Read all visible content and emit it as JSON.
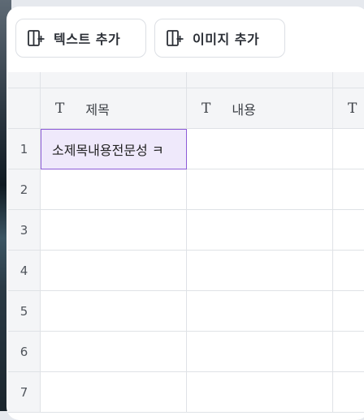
{
  "toolbar": {
    "add_text_label": "텍스트 추가",
    "add_image_label": "이미지 추가"
  },
  "table": {
    "columns": [
      {
        "type_icon": "T",
        "name": "제목"
      },
      {
        "type_icon": "T",
        "name": "내용"
      },
      {
        "type_icon": "T",
        "name": ""
      }
    ],
    "rows": [
      {
        "num": "1",
        "cells": [
          "소제목내용전문성 ㅋ",
          "",
          ""
        ]
      },
      {
        "num": "2",
        "cells": [
          "",
          "",
          ""
        ]
      },
      {
        "num": "3",
        "cells": [
          "",
          "",
          ""
        ]
      },
      {
        "num": "4",
        "cells": [
          "",
          "",
          ""
        ]
      },
      {
        "num": "5",
        "cells": [
          "",
          "",
          ""
        ]
      },
      {
        "num": "6",
        "cells": [
          "",
          "",
          ""
        ]
      },
      {
        "num": "7",
        "cells": [
          "",
          "",
          ""
        ]
      }
    ],
    "selected": {
      "row": 1,
      "col": 1
    }
  },
  "colors": {
    "selection_fill": "#efe9fb",
    "selection_border": "#8d5cd8",
    "header_bg": "#f4f5f7"
  }
}
